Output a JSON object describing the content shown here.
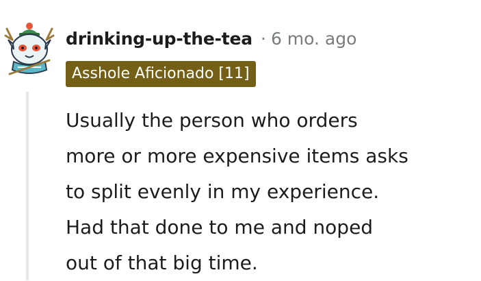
{
  "comment": {
    "username": "drinking-up-the-tea",
    "separator": "·",
    "timestamp": "6 mo. ago",
    "flair": "Asshole Aficionado [11]",
    "flair_color": "#735f15",
    "avatar_icon": "snoo-deer-avatar-icon",
    "body_lines": [
      "Usually the person who orders",
      "more or more expensive items asks",
      "to split evenly in my experience.",
      "Had that done to me and noped",
      "out of that big time."
    ]
  }
}
